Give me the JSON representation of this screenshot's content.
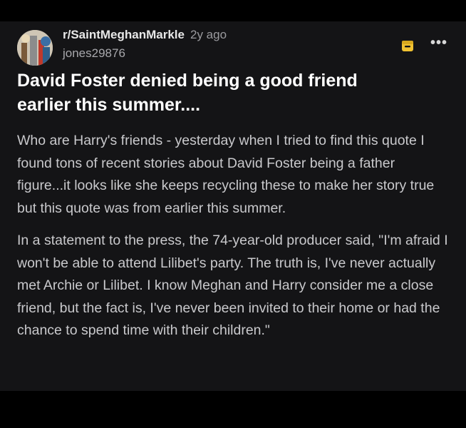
{
  "post": {
    "subreddit": "r/SaintMeghanMarkle",
    "age": "2y ago",
    "username": "jones29876",
    "title_line1": "David Foster denied being a good friend",
    "title_line2": "earlier this summer....",
    "paragraph1": "Who are Harry's friends - yesterday when I tried to find this quote I found tons of recent stories about David Foster being a father figure...it looks like she keeps recycling these to make her story true but this quote was from earlier this summer.",
    "paragraph2": "In a statement to the press, the 74-year-old producer said, \"I'm afraid I won't be able to attend Lilibet's party. The truth is, I've never actually met Archie or Lilibet. I know Meghan and Harry consider me a close friend, but the fact is, I've never been invited to their home or had the chance to spend time with their children.\"",
    "more_label": "•••"
  },
  "icons": {
    "avatar": "subreddit-avatar",
    "mod": "mod-archive-icon",
    "more": "more-options-icon"
  },
  "colors": {
    "background": "#000000",
    "card": "#141416",
    "mod_icon": "#f1c232",
    "title": "#ffffff",
    "body_text": "#c9c9cc"
  }
}
